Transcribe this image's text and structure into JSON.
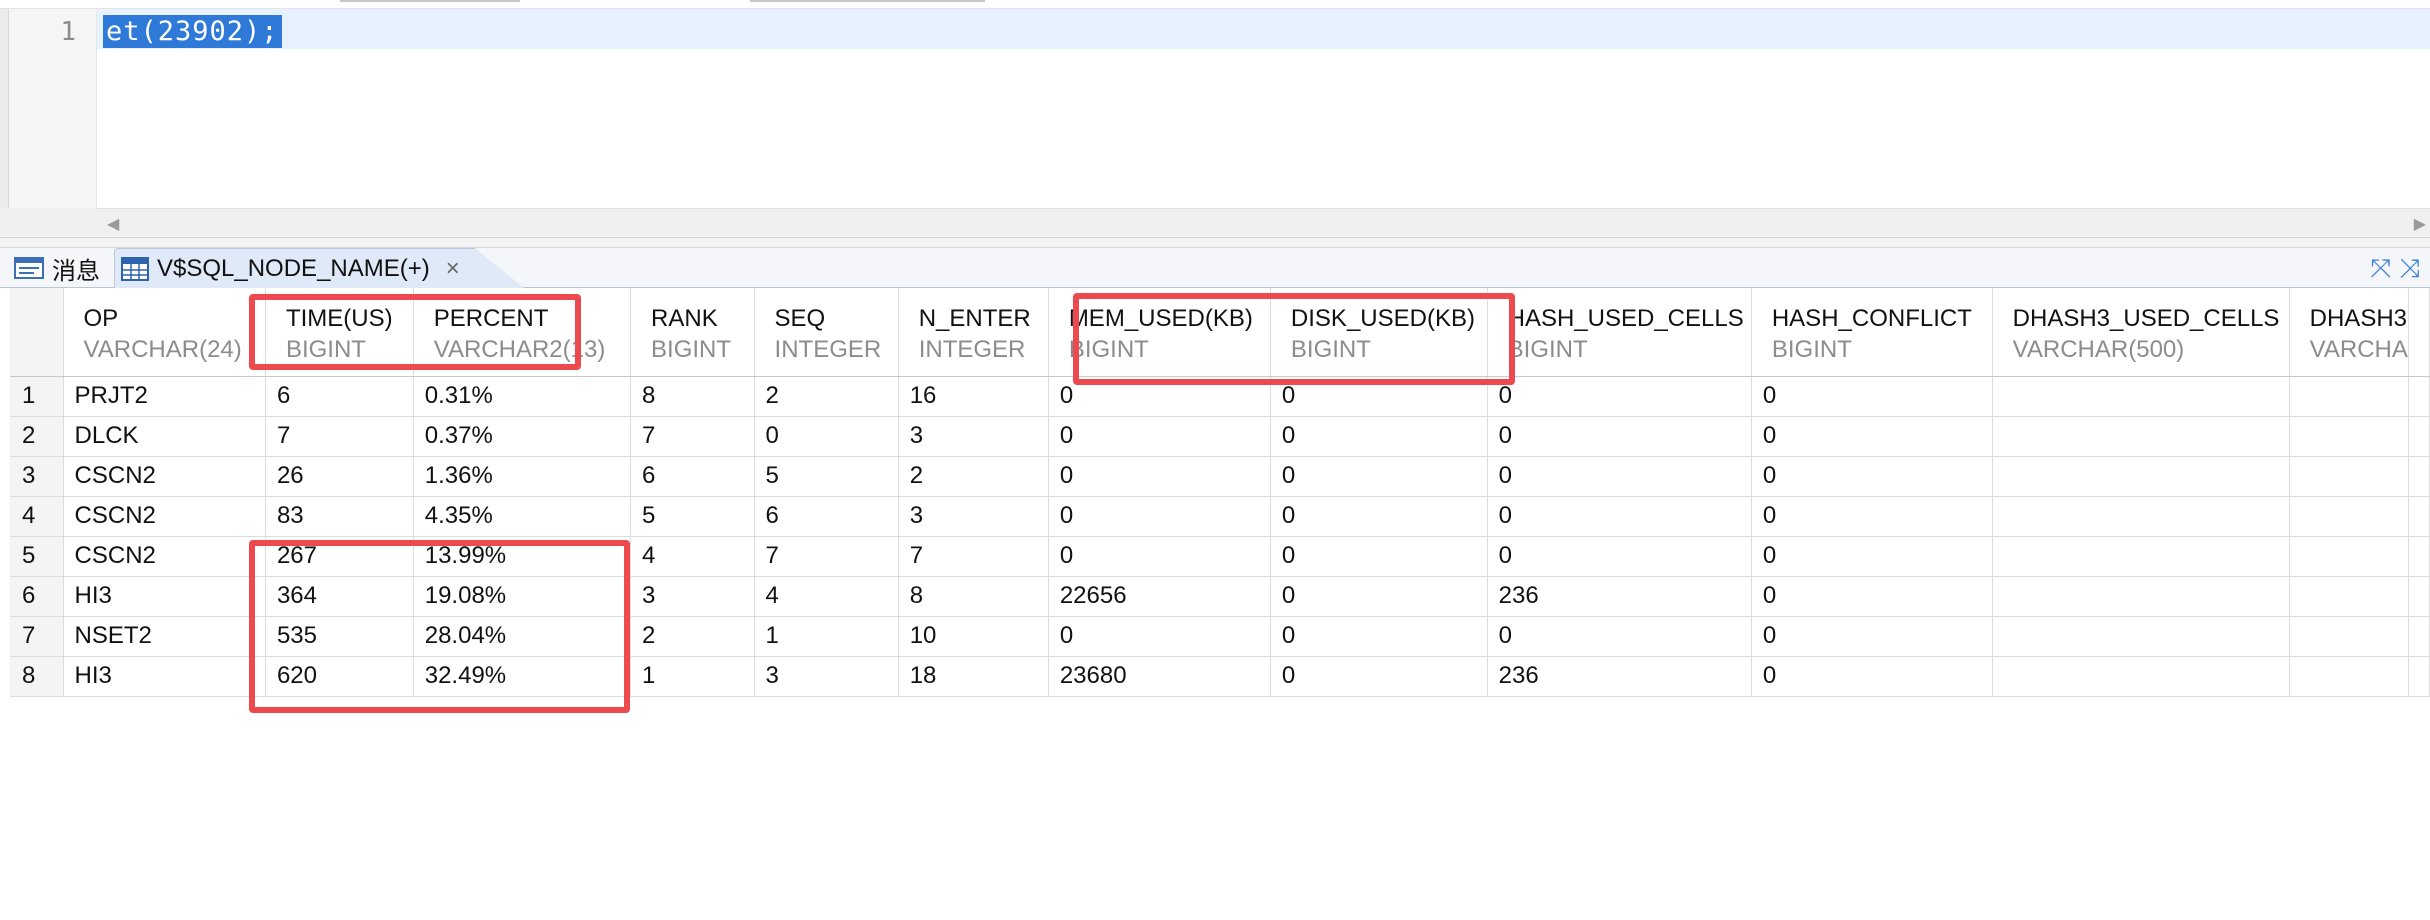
{
  "editor": {
    "line_number": "1",
    "code": "et(23902);"
  },
  "tabs": {
    "messages_label": "消息",
    "result_label": "V$SQL_NODE_NAME(+)",
    "close_glyph": "×"
  },
  "table": {
    "columns": [
      {
        "name": "OP",
        "type": "VARCHAR(24)"
      },
      {
        "name": "TIME(US)",
        "type": "BIGINT"
      },
      {
        "name": "PERCENT",
        "type": "VARCHAR2(13)"
      },
      {
        "name": "RANK",
        "type": "BIGINT"
      },
      {
        "name": "SEQ",
        "type": "INTEGER"
      },
      {
        "name": "N_ENTER",
        "type": "INTEGER"
      },
      {
        "name": "MEM_USED(KB)",
        "type": "BIGINT"
      },
      {
        "name": "DISK_USED(KB)",
        "type": "BIGINT"
      },
      {
        "name": "HASH_USED_CELLS",
        "type": "BIGINT"
      },
      {
        "name": "HASH_CONFLICT",
        "type": "BIGINT"
      },
      {
        "name": "DHASH3_USED_CELLS",
        "type": "VARCHAR(500)"
      },
      {
        "name": "DHASH3",
        "type": "VARCHA"
      }
    ],
    "rows": [
      {
        "num": "1",
        "cells": [
          "PRJT2",
          "6",
          "0.31%",
          "8",
          "2",
          "16",
          "0",
          "0",
          "0",
          "0",
          "",
          ""
        ]
      },
      {
        "num": "2",
        "cells": [
          "DLCK",
          "7",
          "0.37%",
          "7",
          "0",
          "3",
          "0",
          "0",
          "0",
          "0",
          "",
          ""
        ]
      },
      {
        "num": "3",
        "cells": [
          "CSCN2",
          "26",
          "1.36%",
          "6",
          "5",
          "2",
          "0",
          "0",
          "0",
          "0",
          "",
          ""
        ]
      },
      {
        "num": "4",
        "cells": [
          "CSCN2",
          "83",
          "4.35%",
          "5",
          "6",
          "3",
          "0",
          "0",
          "0",
          "0",
          "",
          ""
        ]
      },
      {
        "num": "5",
        "cells": [
          "CSCN2",
          "267",
          "13.99%",
          "4",
          "7",
          "7",
          "0",
          "0",
          "0",
          "0",
          "",
          ""
        ]
      },
      {
        "num": "6",
        "cells": [
          "HI3",
          "364",
          "19.08%",
          "3",
          "4",
          "8",
          "22656",
          "0",
          "236",
          "0",
          "",
          ""
        ]
      },
      {
        "num": "7",
        "cells": [
          "NSET2",
          "535",
          "28.04%",
          "2",
          "1",
          "10",
          "0",
          "0",
          "0",
          "0",
          "",
          ""
        ]
      },
      {
        "num": "8",
        "cells": [
          "HI3",
          "620",
          "32.49%",
          "1",
          "3",
          "18",
          "23680",
          "0",
          "236",
          "0",
          "",
          ""
        ]
      }
    ]
  },
  "colors": {
    "highlight": "#ec4a4f",
    "selection": "#2f7ad8",
    "tab_active": "#dfe9f7"
  }
}
